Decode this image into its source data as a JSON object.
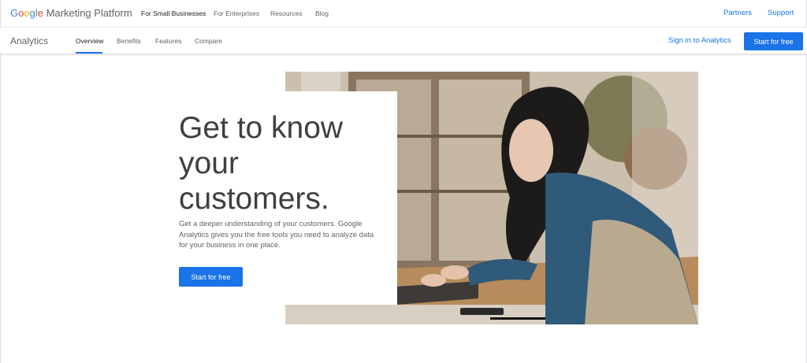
{
  "brand": {
    "google_letters": [
      "G",
      "o",
      "o",
      "g",
      "l",
      "e"
    ],
    "platform": "Marketing Platform"
  },
  "top_nav": {
    "items": [
      "For Small Businesses",
      "For Enterprises",
      "Resources",
      "Blog"
    ],
    "active": "For Small Businesses"
  },
  "top_right": {
    "partners": "Partners",
    "support": "Support"
  },
  "sub_nav": {
    "product": "Analytics",
    "items": [
      "Overview",
      "Benefits",
      "Features",
      "Compare"
    ],
    "active": "Overview",
    "sign_in": "Sign in to Analytics",
    "start": "Start for free"
  },
  "hero": {
    "title_line1": "Get to know",
    "title_line2": "your",
    "title_line3": "customers.",
    "description": "Get a deeper understanding of your customers. Google Analytics gives you the free tools you need to analyze data for your business in one place.",
    "cta": "Start for free"
  },
  "colors": {
    "accent": "#1a73e8",
    "text_primary": "#3c4043",
    "text_secondary": "#5f6368"
  }
}
